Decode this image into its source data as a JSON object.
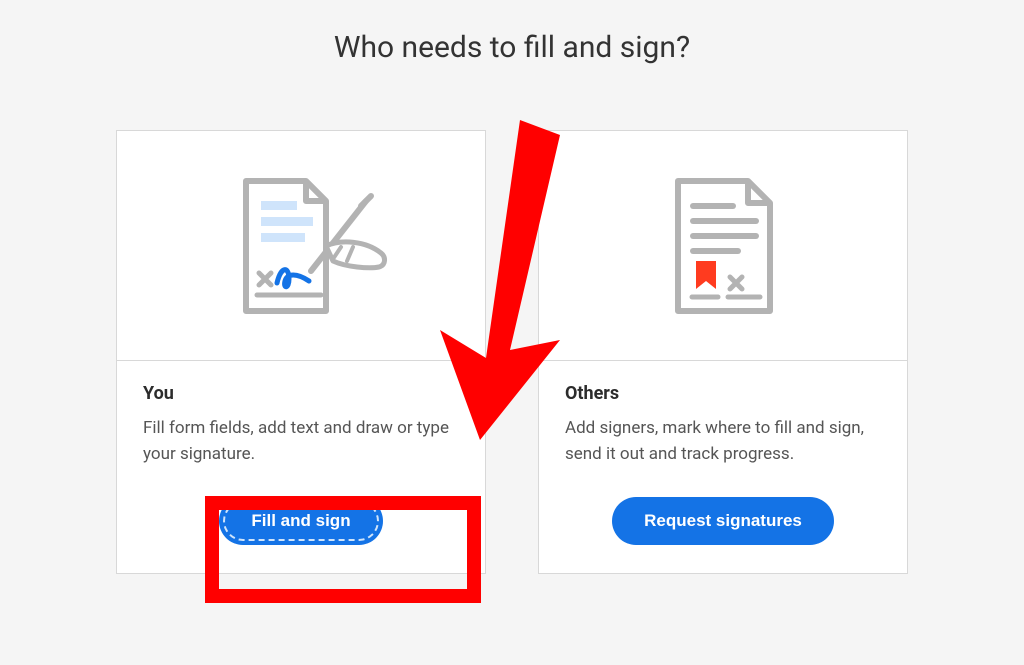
{
  "title": "Who needs to fill and sign?",
  "cards": {
    "you": {
      "heading": "You",
      "desc": "Fill form fields, add text and draw or type your signature.",
      "button": "Fill and sign"
    },
    "others": {
      "heading": "Others",
      "desc": "Add signers, mark where to fill and sign, send it out and track progress.",
      "button": "Request signatures"
    }
  },
  "colors": {
    "accent": "#1473e6",
    "highlight": "#ff0000"
  }
}
